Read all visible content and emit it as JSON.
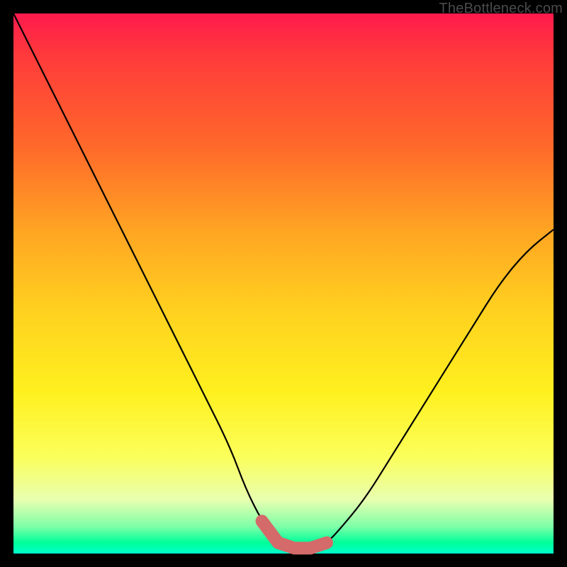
{
  "watermark": "TheBottleneck.com",
  "chart_data": {
    "type": "line",
    "title": "",
    "xlabel": "",
    "ylabel": "",
    "xlim": [
      0,
      100
    ],
    "ylim": [
      0,
      100
    ],
    "series": [
      {
        "name": "bottleneck-curve",
        "x": [
          0,
          5,
          10,
          15,
          20,
          25,
          30,
          35,
          40,
          43,
          46,
          49,
          52,
          55,
          58,
          60,
          65,
          70,
          75,
          80,
          85,
          90,
          95,
          100
        ],
        "values": [
          100,
          90,
          80,
          70,
          60,
          50,
          40,
          30,
          20,
          12,
          6,
          2,
          1,
          1,
          2,
          4,
          10,
          18,
          26,
          34,
          42,
          50,
          56,
          60
        ]
      },
      {
        "name": "optimal-range-highlight",
        "x": [
          46,
          49,
          52,
          55,
          58
        ],
        "values": [
          6,
          2,
          1,
          1,
          2
        ]
      }
    ],
    "colors": {
      "curve": "#000000",
      "highlight": "#d46a6a"
    }
  }
}
